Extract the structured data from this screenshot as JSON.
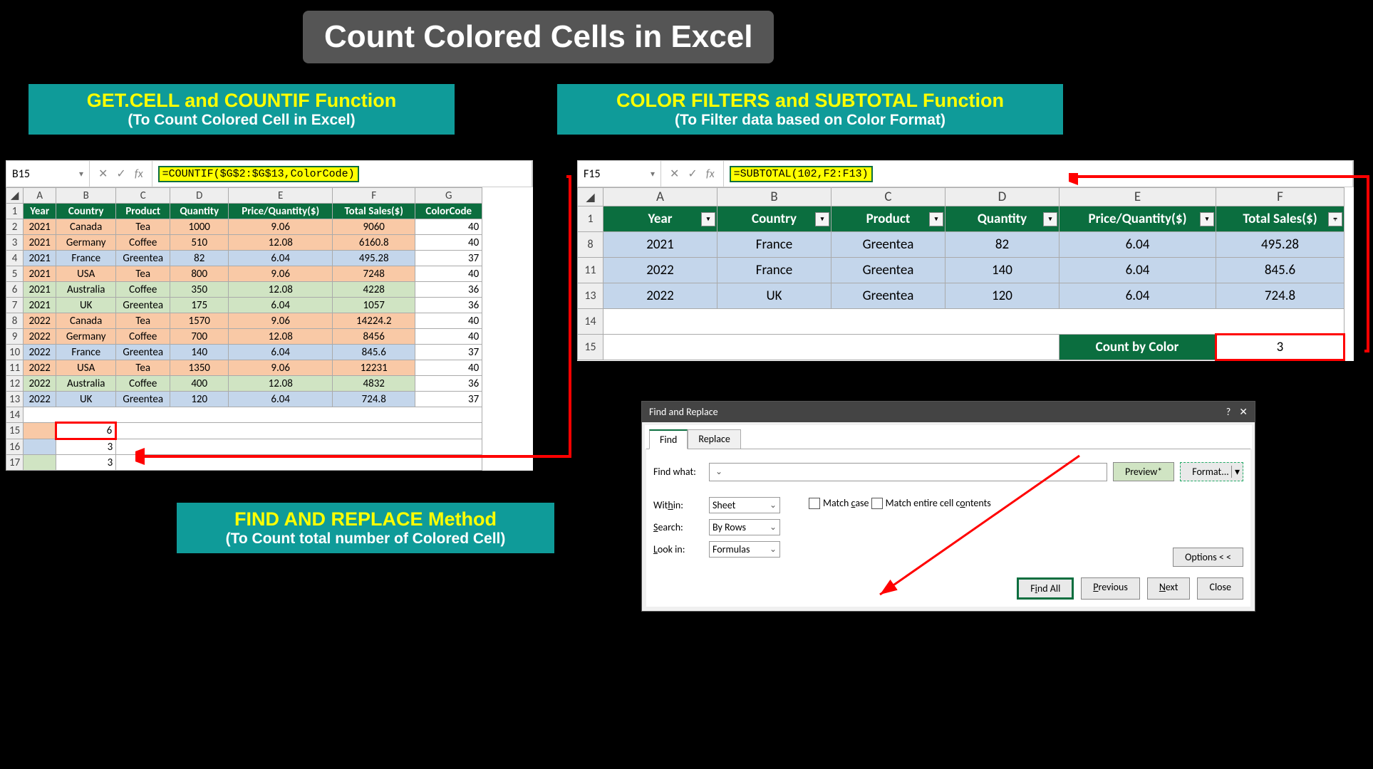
{
  "title": "Count Colored Cells in Excel",
  "caption1": {
    "main": "GET.CELL and COUNTIF Function",
    "sub": "(To Count Colored Cell in Excel)"
  },
  "caption2": {
    "main": "COLOR FILTERS and SUBTOTAL Function",
    "sub": "(To Filter data based on Color Format)"
  },
  "caption3": {
    "main": "FIND AND REPLACE Method",
    "sub": "(To Count total number of Colored Cell)"
  },
  "left": {
    "ref": "B15",
    "formula": "=COUNTIF($G$2:$G$13,ColorCode)",
    "cols": [
      "A",
      "B",
      "C",
      "D",
      "E",
      "F",
      "G"
    ],
    "headers": [
      "Year",
      "Country",
      "Product",
      "Quantity",
      "Price/Quantity($)",
      "Total Sales($)",
      "ColorCode"
    ],
    "rows": [
      {
        "n": "2",
        "fill": "peach",
        "d": [
          "2021",
          "Canada",
          "Tea",
          "1000",
          "9.06",
          "9060",
          "40"
        ]
      },
      {
        "n": "3",
        "fill": "peach",
        "d": [
          "2021",
          "Germany",
          "Coffee",
          "510",
          "12.08",
          "6160.8",
          "40"
        ]
      },
      {
        "n": "4",
        "fill": "blue",
        "d": [
          "2021",
          "France",
          "Greentea",
          "82",
          "6.04",
          "495.28",
          "37"
        ]
      },
      {
        "n": "5",
        "fill": "peach",
        "d": [
          "2021",
          "USA",
          "Tea",
          "800",
          "9.06",
          "7248",
          "40"
        ]
      },
      {
        "n": "6",
        "fill": "green",
        "d": [
          "2021",
          "Australia",
          "Coffee",
          "350",
          "12.08",
          "4228",
          "36"
        ]
      },
      {
        "n": "7",
        "fill": "green",
        "d": [
          "2021",
          "UK",
          "Greentea",
          "175",
          "6.04",
          "1057",
          "36"
        ]
      },
      {
        "n": "8",
        "fill": "peach",
        "d": [
          "2022",
          "Canada",
          "Tea",
          "1570",
          "9.06",
          "14224.2",
          "40"
        ]
      },
      {
        "n": "9",
        "fill": "peach",
        "d": [
          "2022",
          "Germany",
          "Coffee",
          "700",
          "12.08",
          "8456",
          "40"
        ]
      },
      {
        "n": "10",
        "fill": "blue",
        "d": [
          "2022",
          "France",
          "Greentea",
          "140",
          "6.04",
          "845.6",
          "37"
        ]
      },
      {
        "n": "11",
        "fill": "peach",
        "d": [
          "2022",
          "USA",
          "Tea",
          "1350",
          "9.06",
          "12231",
          "40"
        ]
      },
      {
        "n": "12",
        "fill": "green",
        "d": [
          "2022",
          "Australia",
          "Coffee",
          "400",
          "12.08",
          "4832",
          "36"
        ]
      },
      {
        "n": "13",
        "fill": "blue",
        "d": [
          "2022",
          "UK",
          "Greentea",
          "120",
          "6.04",
          "724.8",
          "37"
        ]
      }
    ],
    "results": {
      "r15": "6",
      "r16": "3",
      "r17": "3"
    }
  },
  "right": {
    "ref": "F15",
    "formula": "=SUBTOTAL(102,F2:F13)",
    "cols": [
      "A",
      "B",
      "C",
      "D",
      "E",
      "F"
    ],
    "headers": [
      "Year",
      "Country",
      "Product",
      "Quantity",
      "Price/Quantity($)",
      "Total Sales($)"
    ],
    "rows": [
      {
        "n": "8",
        "d": [
          "2021",
          "France",
          "Greentea",
          "82",
          "6.04",
          "495.28"
        ]
      },
      {
        "n": "11",
        "d": [
          "2022",
          "France",
          "Greentea",
          "140",
          "6.04",
          "845.6"
        ]
      },
      {
        "n": "13",
        "d": [
          "2022",
          "UK",
          "Greentea",
          "120",
          "6.04",
          "724.8"
        ]
      }
    ],
    "count_label": "Count by Color",
    "count_value": "3"
  },
  "dialog": {
    "title": "Find and Replace",
    "tab1": "Find",
    "tab2": "Replace",
    "find_what": "Find what:",
    "preview": "Preview*",
    "format": "Format...",
    "within_l": "Within:",
    "within_v": "Sheet",
    "search_l": "Search:",
    "search_v": "By Rows",
    "lookin_l": "Look in:",
    "lookin_v": "Formulas",
    "match_case": "Match case",
    "match_entire": "Match entire cell contents",
    "options": "Options < <",
    "find_all": "Find All",
    "previous": "Previous",
    "next": "Next",
    "close": "Close"
  }
}
